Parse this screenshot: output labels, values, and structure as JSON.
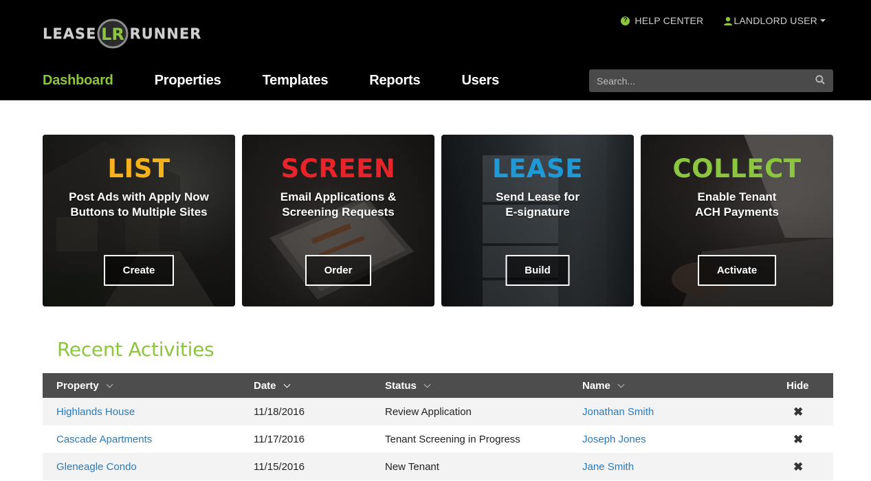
{
  "brand": {
    "name_left": "LEASE",
    "name_right": "RUNNER",
    "mark": "LR"
  },
  "top_links": {
    "help": "HELP CENTER",
    "user": "LANDLORD USER"
  },
  "nav": {
    "items": [
      "Dashboard",
      "Properties",
      "Templates",
      "Reports",
      "Users"
    ],
    "active": "Dashboard"
  },
  "search": {
    "placeholder": "Search..."
  },
  "cards": [
    {
      "title": "LIST",
      "color": "#f6b21b",
      "desc": "Post Ads with Apply Now\nButtons to Multiple Sites",
      "button": "Create"
    },
    {
      "title": "SCREEN",
      "color": "#e8232a",
      "desc": "Email Applications &\nScreening Requests",
      "button": "Order"
    },
    {
      "title": "LEASE",
      "color": "#1f9ad6",
      "desc": "Send Lease for\nE-signature",
      "button": "Build"
    },
    {
      "title": "COLLECT",
      "color": "#8cc63f",
      "desc": "Enable Tenant\nACH Payments",
      "button": "Activate"
    }
  ],
  "activities": {
    "title": "Recent Activities",
    "headers": {
      "property": "Property",
      "date": "Date",
      "status": "Status",
      "name": "Name",
      "hide": "Hide"
    },
    "rows": [
      {
        "property": "Highlands House",
        "date": "11/18/2016",
        "status": "Review Application",
        "name": "Jonathan Smith"
      },
      {
        "property": "Cascade Apartments",
        "date": "11/17/2016",
        "status": "Tenant Screening in Progress",
        "name": "Joseph Jones"
      },
      {
        "property": "Gleneagle Condo",
        "date": "11/15/2016",
        "status": "New Tenant",
        "name": "Jane Smith"
      }
    ]
  },
  "colors": {
    "accent_green": "#8cc63f",
    "link_blue": "#2a7ab8",
    "header_bg": "#000000",
    "table_header_bg": "#4d4d4d"
  },
  "icons": {
    "help": "question-circle-icon",
    "user": "user-icon",
    "search": "magnifier-icon",
    "hide": "close-x-icon"
  }
}
